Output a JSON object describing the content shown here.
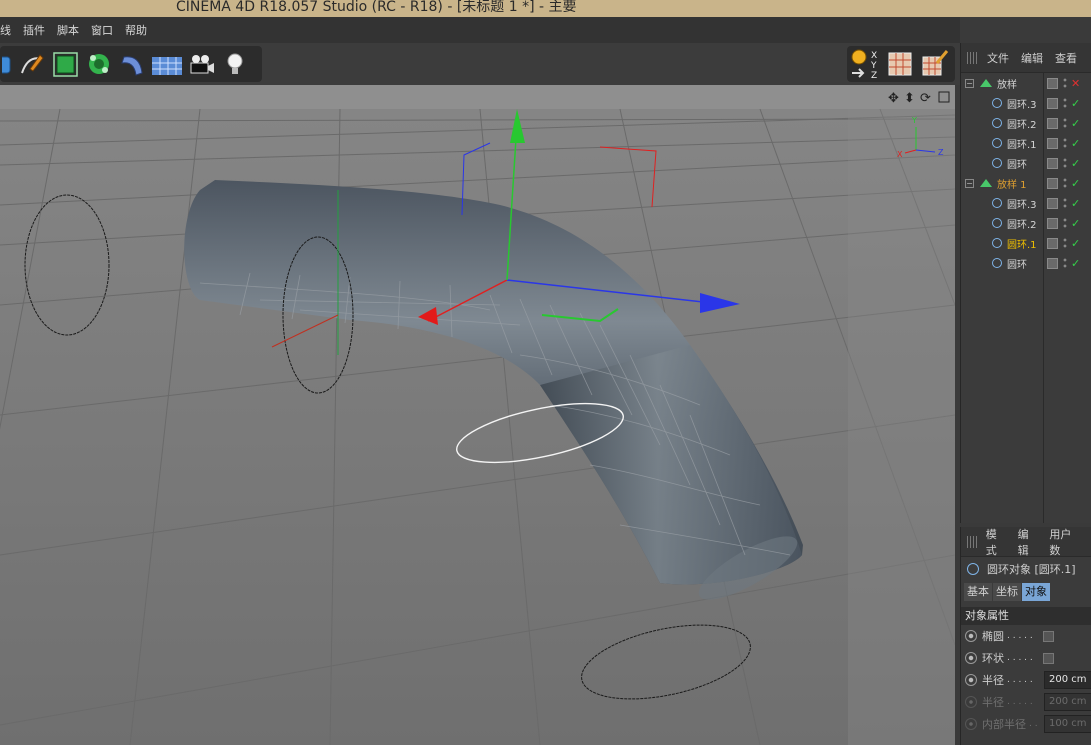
{
  "window": {
    "title": "CINEMA 4D R18.057 Studio (RC - R18) - [未标题 1 *] - 主要"
  },
  "menu": {
    "items": [
      "线",
      "插件",
      "脚本",
      "窗口",
      "帮助"
    ]
  },
  "toolbar": {
    "icons": [
      "cube-icon",
      "pen-spline-icon",
      "nurbs-cube-icon",
      "subdivision-icon",
      "deformer-bend-icon",
      "floor-plane-icon",
      "camera-icon",
      "light-bulb-icon"
    ],
    "right_icons": [
      "coordinate-system-icon",
      "render-view-icon",
      "render-settings-icon"
    ],
    "coord_letters": [
      "X",
      "Y",
      "Z"
    ]
  },
  "viewport": {
    "nav_icons": [
      "move-view-icon",
      "zoom-view-icon",
      "rotate-view-icon",
      "maximize-view-icon"
    ],
    "axis_labels": {
      "x": "X",
      "y": "Y",
      "z": "Z"
    }
  },
  "object_manager": {
    "menu": [
      "文件",
      "编辑",
      "查看"
    ],
    "objects": [
      {
        "name": "放样",
        "type": "loft",
        "level": 0,
        "status": "x"
      },
      {
        "name": "圆环.3",
        "type": "circle",
        "level": 1,
        "status": "check"
      },
      {
        "name": "圆环.2",
        "type": "circle",
        "level": 1,
        "status": "check"
      },
      {
        "name": "圆环.1",
        "type": "circle",
        "level": 1,
        "status": "check"
      },
      {
        "name": "圆环",
        "type": "circle",
        "level": 1,
        "status": "check"
      },
      {
        "name": "放样 1",
        "type": "loft",
        "level": 0,
        "status": "check",
        "highlight": "orange"
      },
      {
        "name": "圆环.3",
        "type": "circle",
        "level": 1,
        "status": "check"
      },
      {
        "name": "圆环.2",
        "type": "circle",
        "level": 1,
        "status": "check"
      },
      {
        "name": "圆环.1",
        "type": "circle",
        "level": 1,
        "status": "check",
        "highlight": "yellow"
      },
      {
        "name": "圆环",
        "type": "circle",
        "level": 1,
        "status": "check"
      }
    ]
  },
  "attribute_manager": {
    "menu": [
      "模式",
      "编辑",
      "用户数"
    ],
    "object_title": "圆环对象 [圆环.1]",
    "tabs": [
      "基本",
      "坐标",
      "对象"
    ],
    "active_tab": "对象",
    "section": "对象属性",
    "rows": [
      {
        "label": "椭圆",
        "dots": ". . . . .",
        "kind": "checkbox",
        "value": ""
      },
      {
        "label": "环状",
        "dots": ". . . . .",
        "kind": "checkbox",
        "value": ""
      },
      {
        "label": "半径",
        "dots": ". . . . .",
        "kind": "field",
        "value": "200 cm"
      },
      {
        "label": "半径",
        "dots": ". . . . .",
        "kind": "field",
        "value": "200 cm",
        "disabled": true
      },
      {
        "label": "内部半径",
        "dots": ". .",
        "kind": "field",
        "value": "100 cm",
        "disabled": true
      }
    ]
  }
}
